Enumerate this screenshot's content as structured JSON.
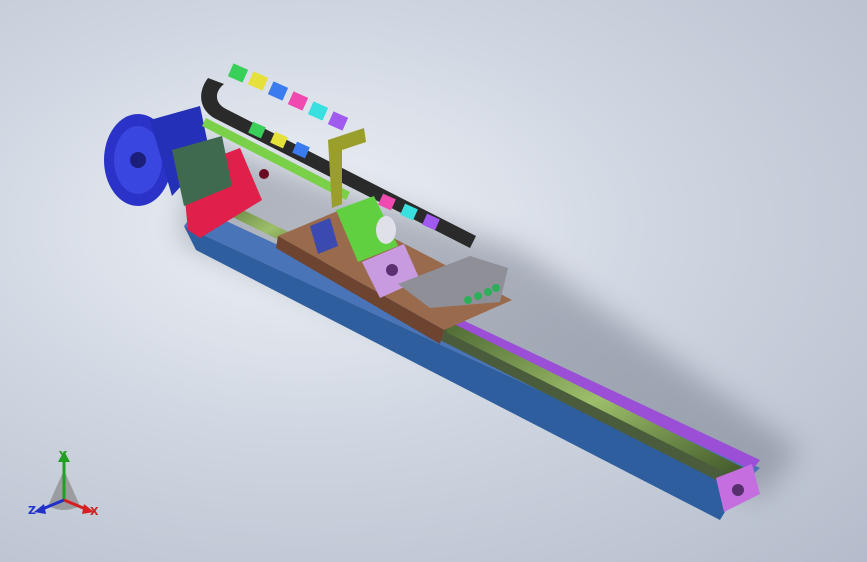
{
  "triad": {
    "x_label": "X",
    "y_label": "Y",
    "z_label": "Z",
    "x_color": "#d42020",
    "y_color": "#20a020",
    "z_color": "#2030c8"
  },
  "model": {
    "base_rail_color": "#2f5e9e",
    "rail_side_color": "#9a4fd6",
    "carriage_color": "#9a6a4c",
    "motor_color": "#2a32c8",
    "bracket_color": "#e0204a",
    "drag_chain_colors": [
      "#2a2a2a",
      "#39d05a",
      "#e6e03a",
      "#3a7cf0",
      "#f04ab0",
      "#3ae0e0",
      "#a05af0"
    ],
    "lead_screw_color": "#5d7a3f",
    "cylinder_color": "#60d040",
    "bracket_pink_color": "#c89ae0",
    "gray_block_color": "#8f8f98"
  }
}
